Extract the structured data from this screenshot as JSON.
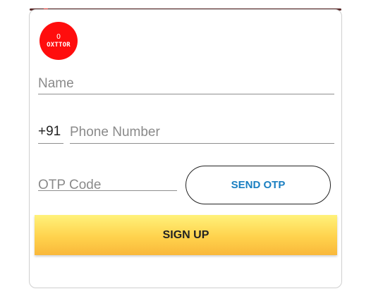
{
  "logo": {
    "mark": "O",
    "name": "OXTTOR"
  },
  "form": {
    "name_placeholder": "Name",
    "country_code": "+91",
    "phone_placeholder": "Phone Number",
    "otp_placeholder": "OTP Code",
    "send_otp_label": "SEND OTP",
    "sign_up_label": "SIGN UP"
  },
  "colors": {
    "logo_bg": "#ff0d0d",
    "send_otp_text": "#1a7fc1",
    "sign_up_bg": "#ffd24d"
  }
}
